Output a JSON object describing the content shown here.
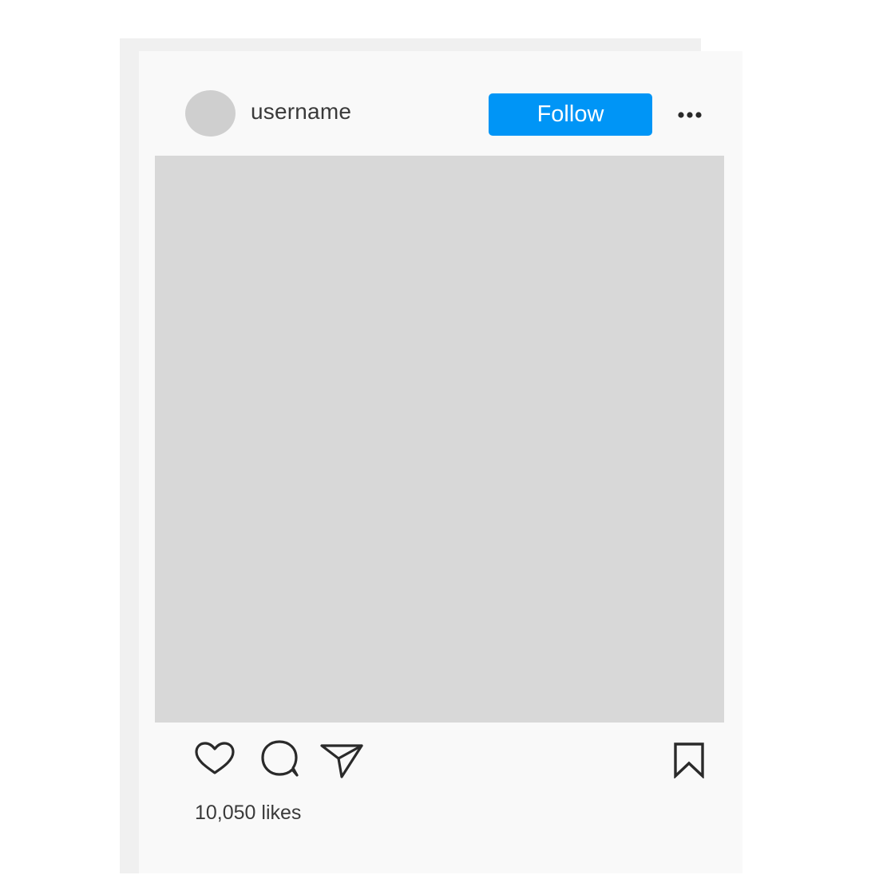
{
  "post": {
    "username": "username",
    "follow_label": "Follow",
    "likes_text": "10,050 likes"
  },
  "icons": {
    "more": "more-dots-icon",
    "like": "heart-icon",
    "comment": "comment-bubble-icon",
    "share": "paper-plane-icon",
    "save": "bookmark-icon"
  },
  "colors": {
    "follow_button": "#0095f6",
    "photo_placeholder": "#d8d8d8",
    "avatar": "#cfcfcf",
    "card_background": "#f9f9f9",
    "back_card": "#f0f0f0"
  }
}
